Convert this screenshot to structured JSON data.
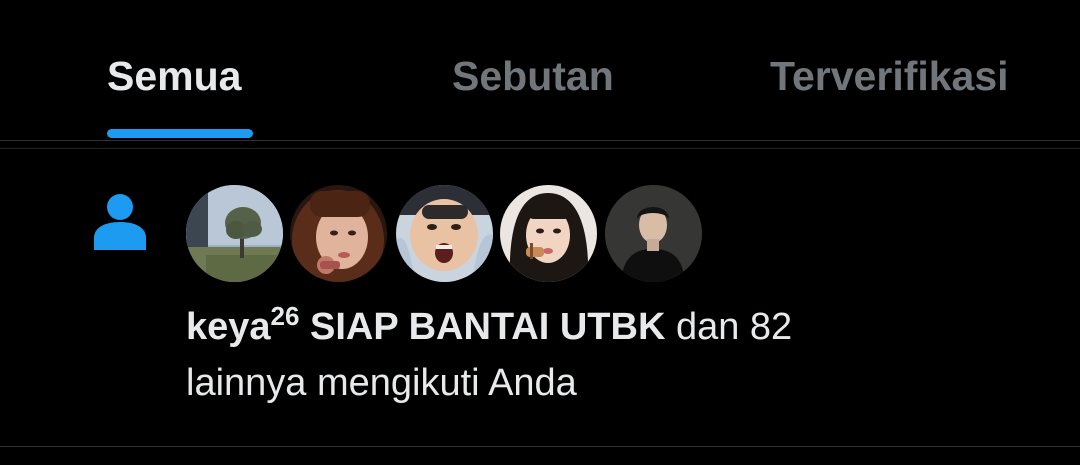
{
  "tabs": {
    "all": "Semua",
    "mentions": "Sebutan",
    "verified": "Terverifikasi",
    "active": "Semua"
  },
  "colors": {
    "background": "#000000",
    "text_primary": "#e7e9ea",
    "text_secondary": "#71767b",
    "accent": "#1d9bf0",
    "divider": "#2f3336"
  },
  "notification": {
    "icon": "person-icon",
    "avatars": [
      "avatar-1",
      "avatar-2",
      "avatar-3",
      "avatar-4",
      "avatar-5"
    ],
    "user_name": "keya",
    "user_name_sup": "26",
    "user_name_rest": " SIAP BANTAI UTBK",
    "line1_suffix": " dan 82",
    "line2": "lainnya mengikuti Anda"
  }
}
